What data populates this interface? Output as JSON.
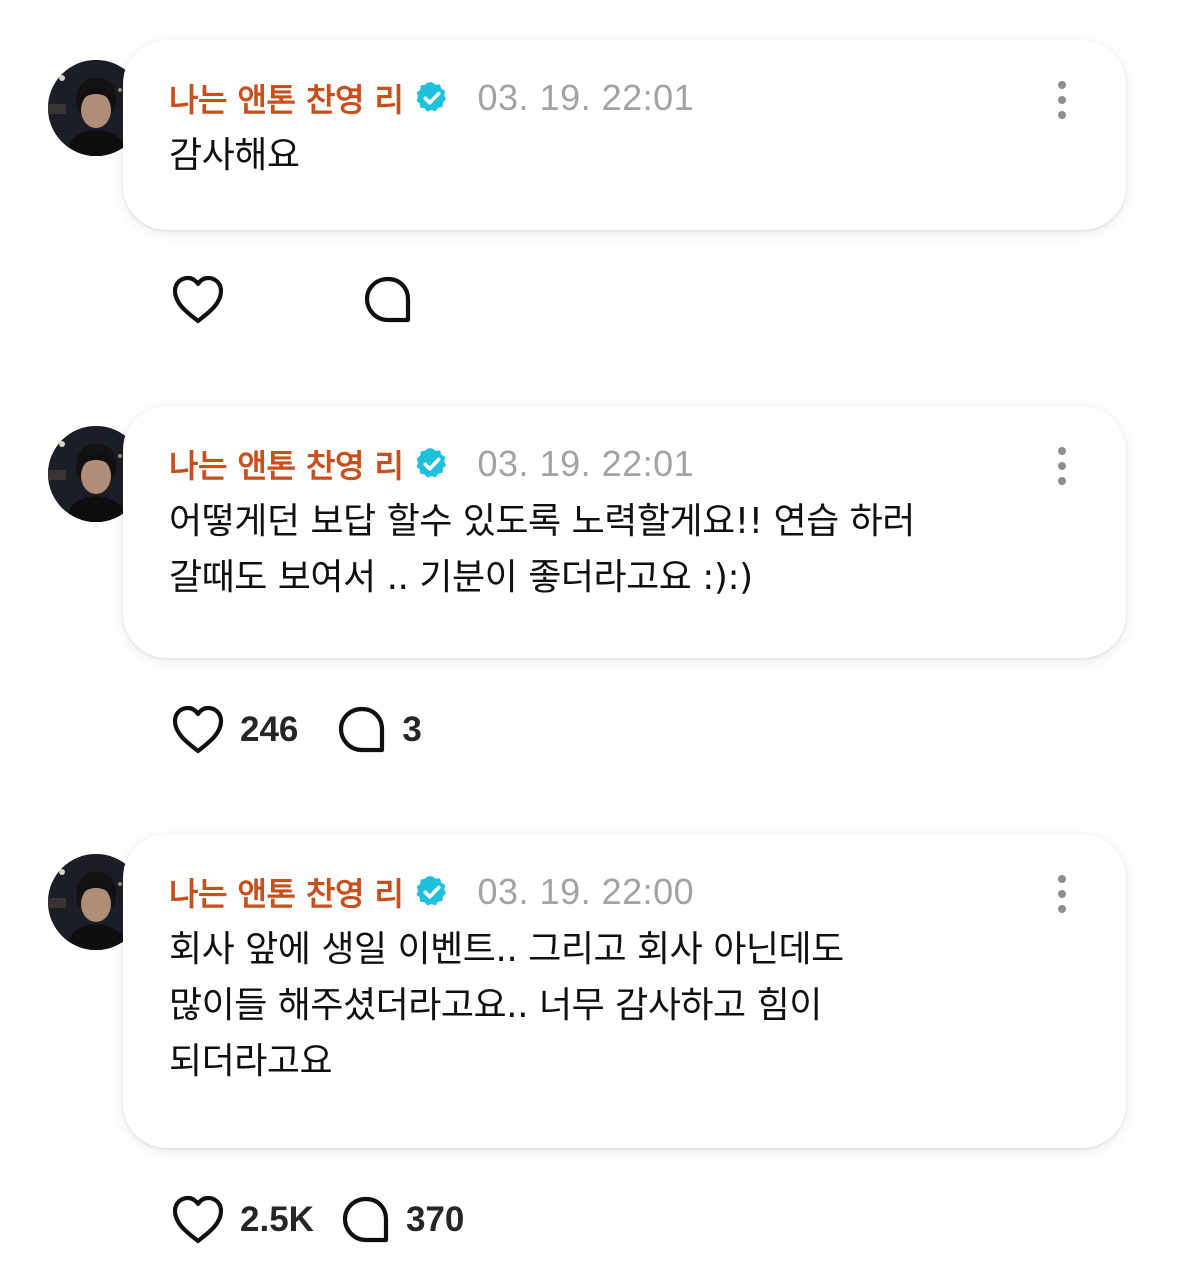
{
  "posts": [
    {
      "author": "나는 앤톤 찬영 리",
      "timestamp": "03. 19. 22:01",
      "text": "감사해요",
      "likes": "",
      "replies": ""
    },
    {
      "author": "나는 앤톤 찬영 리",
      "timestamp": "03. 19. 22:01",
      "text": "어떻게던 보답 할수 있도록 노력할게요!! 연습 하러\n갈때도 보여서 .. 기분이 좋더라고요 :):)",
      "likes": "246",
      "replies": "3"
    },
    {
      "author": "나는 앤톤 찬영 리",
      "timestamp": "03. 19. 22:00",
      "text": "회사 앞에 생일 이벤트.. 그리고 회사 아닌데도\n많이들 해주셨더라고요.. 너무 감사하고 힘이\n되더라고요",
      "likes": "2.5K",
      "replies": "370"
    }
  ],
  "icons": {
    "verified": "verified-badge-icon",
    "more": "more-vertical-icon",
    "like": "heart-icon",
    "reply": "speech-bubble-icon"
  },
  "colors": {
    "author": "#c8501d",
    "verified": "#1ec0dc",
    "timestamp": "#a3a3a3",
    "text": "#101010",
    "count": "#262626"
  }
}
